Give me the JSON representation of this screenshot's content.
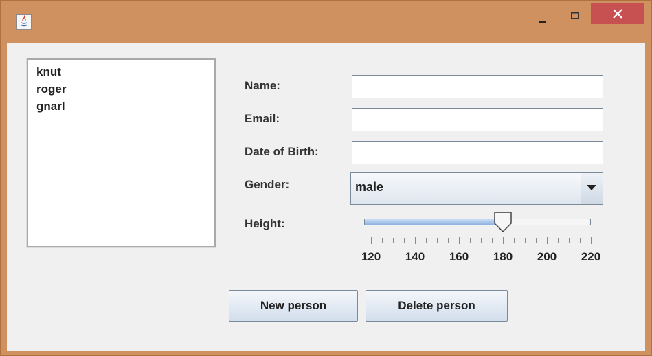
{
  "window": {
    "app_icon": "java-icon",
    "minimize_icon": "minimize-icon",
    "maximize_icon": "maximize-icon",
    "close_icon": "close-icon"
  },
  "people_list": {
    "items": [
      "knut",
      "roger",
      "gnarl"
    ]
  },
  "form": {
    "name_label": "Name:",
    "name_value": "",
    "email_label": "Email:",
    "email_value": "",
    "dob_label": "Date of Birth:",
    "dob_value": "",
    "gender_label": "Gender:",
    "gender_value": "male",
    "height_label": "Height:",
    "height": {
      "min": 120,
      "max": 220,
      "value": 180,
      "major_ticks": [
        "120",
        "140",
        "160",
        "180",
        "200",
        "220"
      ],
      "minor_step": 5
    }
  },
  "buttons": {
    "new_person": "New person",
    "delete_person": "Delete person"
  },
  "colors": {
    "frame": "#cf9160",
    "close": "#c75050",
    "panel": "#f0f0f0"
  }
}
